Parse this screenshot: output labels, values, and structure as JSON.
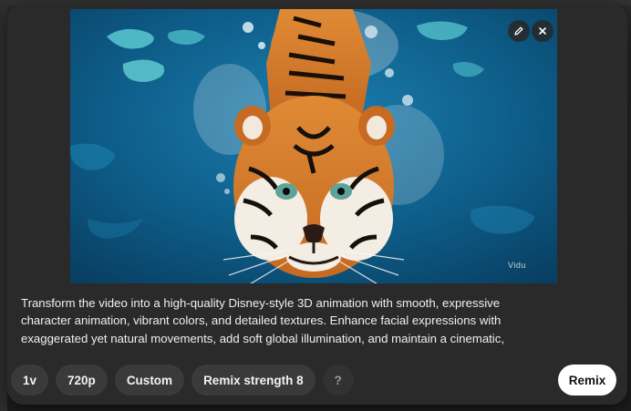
{
  "media": {
    "edit_icon": "pencil-icon",
    "close_icon": "close-icon",
    "watermark": "Vidu"
  },
  "prompt_text": "Transform the video into a high-quality Disney-style 3D animation with smooth, expressive\ncharacter animation, vibrant colors, and detailed textures. Enhance facial expressions with\nexaggerated yet natural movements, add soft global illumination, and maintain a cinematic,",
  "options": {
    "variations": "1v",
    "resolution": "720p",
    "preset": "Custom",
    "remix_strength": "Remix strength 8",
    "help": "?"
  },
  "remix_button": "Remix",
  "colors": {
    "dialog_bg": "#2a2a2a",
    "chip_bg": "#3a3a3a",
    "remix_bg": "#ffffff",
    "water": "#0e5b87",
    "tiger_orange": "#d87a2a"
  }
}
